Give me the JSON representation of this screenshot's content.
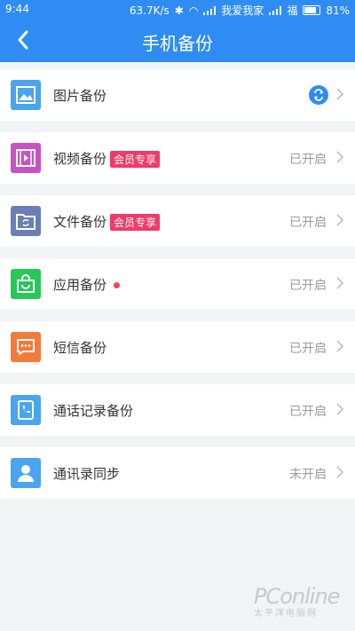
{
  "statusbar": {
    "time": "9:44",
    "speed": "63.7K/s",
    "carrier": "我爱我家",
    "carrier2": "福",
    "battery": "81%",
    "battery_level": 0.81
  },
  "header": {
    "title": "手机备份"
  },
  "items": [
    {
      "label": "图片备份",
      "badge": "",
      "status": "",
      "icon": "image-icon",
      "color": "#4aa4f0"
    },
    {
      "label": "视频备份",
      "badge": "会员专享",
      "status": "已开启",
      "icon": "video-icon",
      "color": "#c852c5"
    },
    {
      "label": "文件备份",
      "badge": "会员专享",
      "status": "已开启",
      "icon": "folder-sync-icon",
      "color": "#6b7eb8"
    },
    {
      "label": "应用备份",
      "badge": "",
      "status": "已开启",
      "icon": "bag-icon",
      "color": "#27c75a"
    },
    {
      "label": "短信备份",
      "badge": "",
      "status": "已开启",
      "icon": "message-icon",
      "color": "#f27a3a"
    },
    {
      "label": "通话记录备份",
      "badge": "",
      "status": "已开启",
      "icon": "call-log-icon",
      "color": "#4aa4f0"
    },
    {
      "label": "通讯录同步",
      "badge": "",
      "status": "未开启",
      "icon": "contact-icon",
      "color": "#4aa4f0"
    }
  ],
  "watermark": {
    "line1": "PConline",
    "line2": "太平洋电脑网"
  }
}
